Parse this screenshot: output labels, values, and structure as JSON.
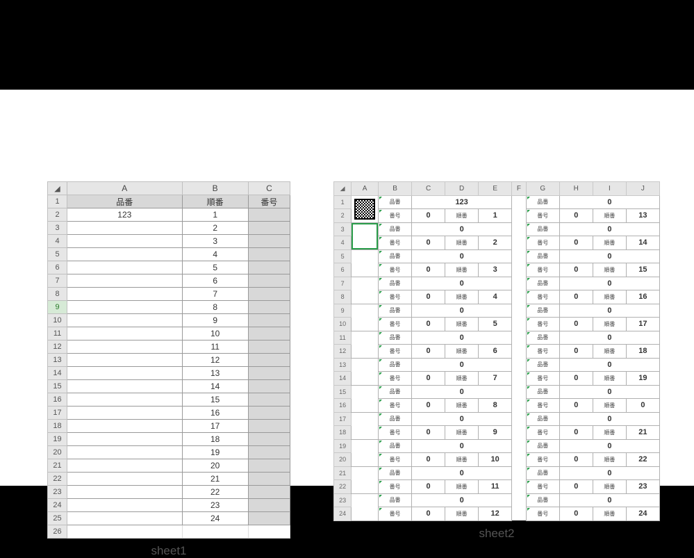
{
  "labels": {
    "sheet1": "sheet1",
    "sheet2": "sheet2",
    "hinban": "品番",
    "junban": "順番",
    "bango": "番号"
  },
  "sheet1": {
    "columns": [
      "A",
      "B",
      "C"
    ],
    "rowNumbers": [
      1,
      2,
      3,
      4,
      5,
      6,
      7,
      8,
      9,
      10,
      11,
      12,
      13,
      14,
      15,
      16,
      17,
      18,
      19,
      20,
      21,
      22,
      23,
      24,
      25,
      26
    ],
    "selectedRow": 9,
    "rows": [
      {
        "A": "品番",
        "B": "順番",
        "C": "番号",
        "shaded": true
      },
      {
        "A": "123",
        "B": "1",
        "C": "",
        "Cshaded": true
      },
      {
        "A": "",
        "B": "2",
        "C": "",
        "Cshaded": true
      },
      {
        "A": "",
        "B": "3",
        "C": "",
        "Cshaded": true
      },
      {
        "A": "",
        "B": "4",
        "C": "",
        "Cshaded": true
      },
      {
        "A": "",
        "B": "5",
        "C": "",
        "Cshaded": true
      },
      {
        "A": "",
        "B": "6",
        "C": "",
        "Cshaded": true
      },
      {
        "A": "",
        "B": "7",
        "C": "",
        "Cshaded": true
      },
      {
        "A": "",
        "B": "8",
        "C": "",
        "Cshaded": true
      },
      {
        "A": "",
        "B": "9",
        "C": "",
        "Cshaded": true
      },
      {
        "A": "",
        "B": "10",
        "C": "",
        "Cshaded": true
      },
      {
        "A": "",
        "B": "11",
        "C": "",
        "Cshaded": true
      },
      {
        "A": "",
        "B": "12",
        "C": "",
        "Cshaded": true
      },
      {
        "A": "",
        "B": "13",
        "C": "",
        "Cshaded": true
      },
      {
        "A": "",
        "B": "14",
        "C": "",
        "Cshaded": true
      },
      {
        "A": "",
        "B": "15",
        "C": "",
        "Cshaded": true
      },
      {
        "A": "",
        "B": "16",
        "C": "",
        "Cshaded": true
      },
      {
        "A": "",
        "B": "17",
        "C": "",
        "Cshaded": true
      },
      {
        "A": "",
        "B": "18",
        "C": "",
        "Cshaded": true
      },
      {
        "A": "",
        "B": "19",
        "C": "",
        "Cshaded": true
      },
      {
        "A": "",
        "B": "20",
        "C": "",
        "Cshaded": true
      },
      {
        "A": "",
        "B": "21",
        "C": "",
        "Cshaded": true
      },
      {
        "A": "",
        "B": "22",
        "C": "",
        "Cshaded": true
      },
      {
        "A": "",
        "B": "23",
        "C": "",
        "Cshaded": true
      },
      {
        "A": "",
        "B": "24",
        "C": "",
        "Cshaded": true
      }
    ]
  },
  "sheet2": {
    "columns": [
      "A",
      "B",
      "C",
      "D",
      "E",
      "F",
      "G",
      "H",
      "I",
      "J"
    ],
    "rowNumbers": [
      1,
      2,
      3,
      4,
      5,
      6,
      7,
      8,
      9,
      10,
      11,
      12,
      13,
      14,
      15,
      16,
      17,
      18,
      19,
      20,
      21,
      22,
      23,
      24
    ],
    "selectedCell": "A3",
    "blocks": {
      "left": [
        {
          "pin": "123",
          "bango": "0",
          "jun": "1"
        },
        {
          "pin": "0",
          "bango": "0",
          "jun": "2"
        },
        {
          "pin": "0",
          "bango": "0",
          "jun": "3"
        },
        {
          "pin": "0",
          "bango": "0",
          "jun": "4"
        },
        {
          "pin": "0",
          "bango": "0",
          "jun": "5"
        },
        {
          "pin": "0",
          "bango": "0",
          "jun": "6"
        },
        {
          "pin": "0",
          "bango": "0",
          "jun": "7"
        },
        {
          "pin": "0",
          "bango": "0",
          "jun": "8"
        },
        {
          "pin": "0",
          "bango": "0",
          "jun": "9"
        },
        {
          "pin": "0",
          "bango": "0",
          "jun": "10"
        },
        {
          "pin": "0",
          "bango": "0",
          "jun": "11"
        },
        {
          "pin": "0",
          "bango": "0",
          "jun": "12"
        }
      ],
      "right": [
        {
          "pin": "0",
          "bango": "0",
          "jun": "13"
        },
        {
          "pin": "0",
          "bango": "0",
          "jun": "14"
        },
        {
          "pin": "0",
          "bango": "0",
          "jun": "15"
        },
        {
          "pin": "0",
          "bango": "0",
          "jun": "16"
        },
        {
          "pin": "0",
          "bango": "0",
          "jun": "17"
        },
        {
          "pin": "0",
          "bango": "0",
          "jun": "18"
        },
        {
          "pin": "0",
          "bango": "0",
          "jun": "19"
        },
        {
          "pin": "0",
          "bango": "0",
          "jun": "0"
        },
        {
          "pin": "0",
          "bango": "0",
          "jun": "21"
        },
        {
          "pin": "0",
          "bango": "0",
          "jun": "22"
        },
        {
          "pin": "0",
          "bango": "0",
          "jun": "23"
        },
        {
          "pin": "0",
          "bango": "0",
          "jun": "24"
        }
      ]
    }
  }
}
